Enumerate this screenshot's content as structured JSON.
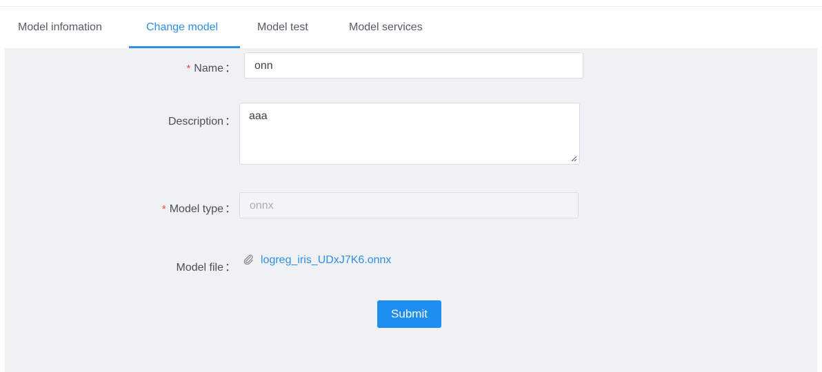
{
  "tabs": [
    {
      "label": "Model infomation"
    },
    {
      "label": "Change model"
    },
    {
      "label": "Model test"
    },
    {
      "label": "Model services"
    }
  ],
  "active_tab": "Change model",
  "form": {
    "name": {
      "label": "Name",
      "required": true,
      "value": "onn"
    },
    "description": {
      "label": "Description",
      "required": false,
      "value": "aaa"
    },
    "model_type": {
      "label": "Model type",
      "required": true,
      "value": "onnx",
      "disabled": true
    },
    "model_file": {
      "label": "Model file",
      "file_name": "logreg_iris_UDxJ7K6.onnx",
      "icon": "paperclip-icon"
    },
    "colon": "：",
    "required_mark": "*"
  },
  "submit_label": "Submit",
  "colors": {
    "accent": "#2f8ee6",
    "primary_button": "#1f8ef1",
    "required": "#f04a3f",
    "content_bg": "#f0f1f5"
  }
}
